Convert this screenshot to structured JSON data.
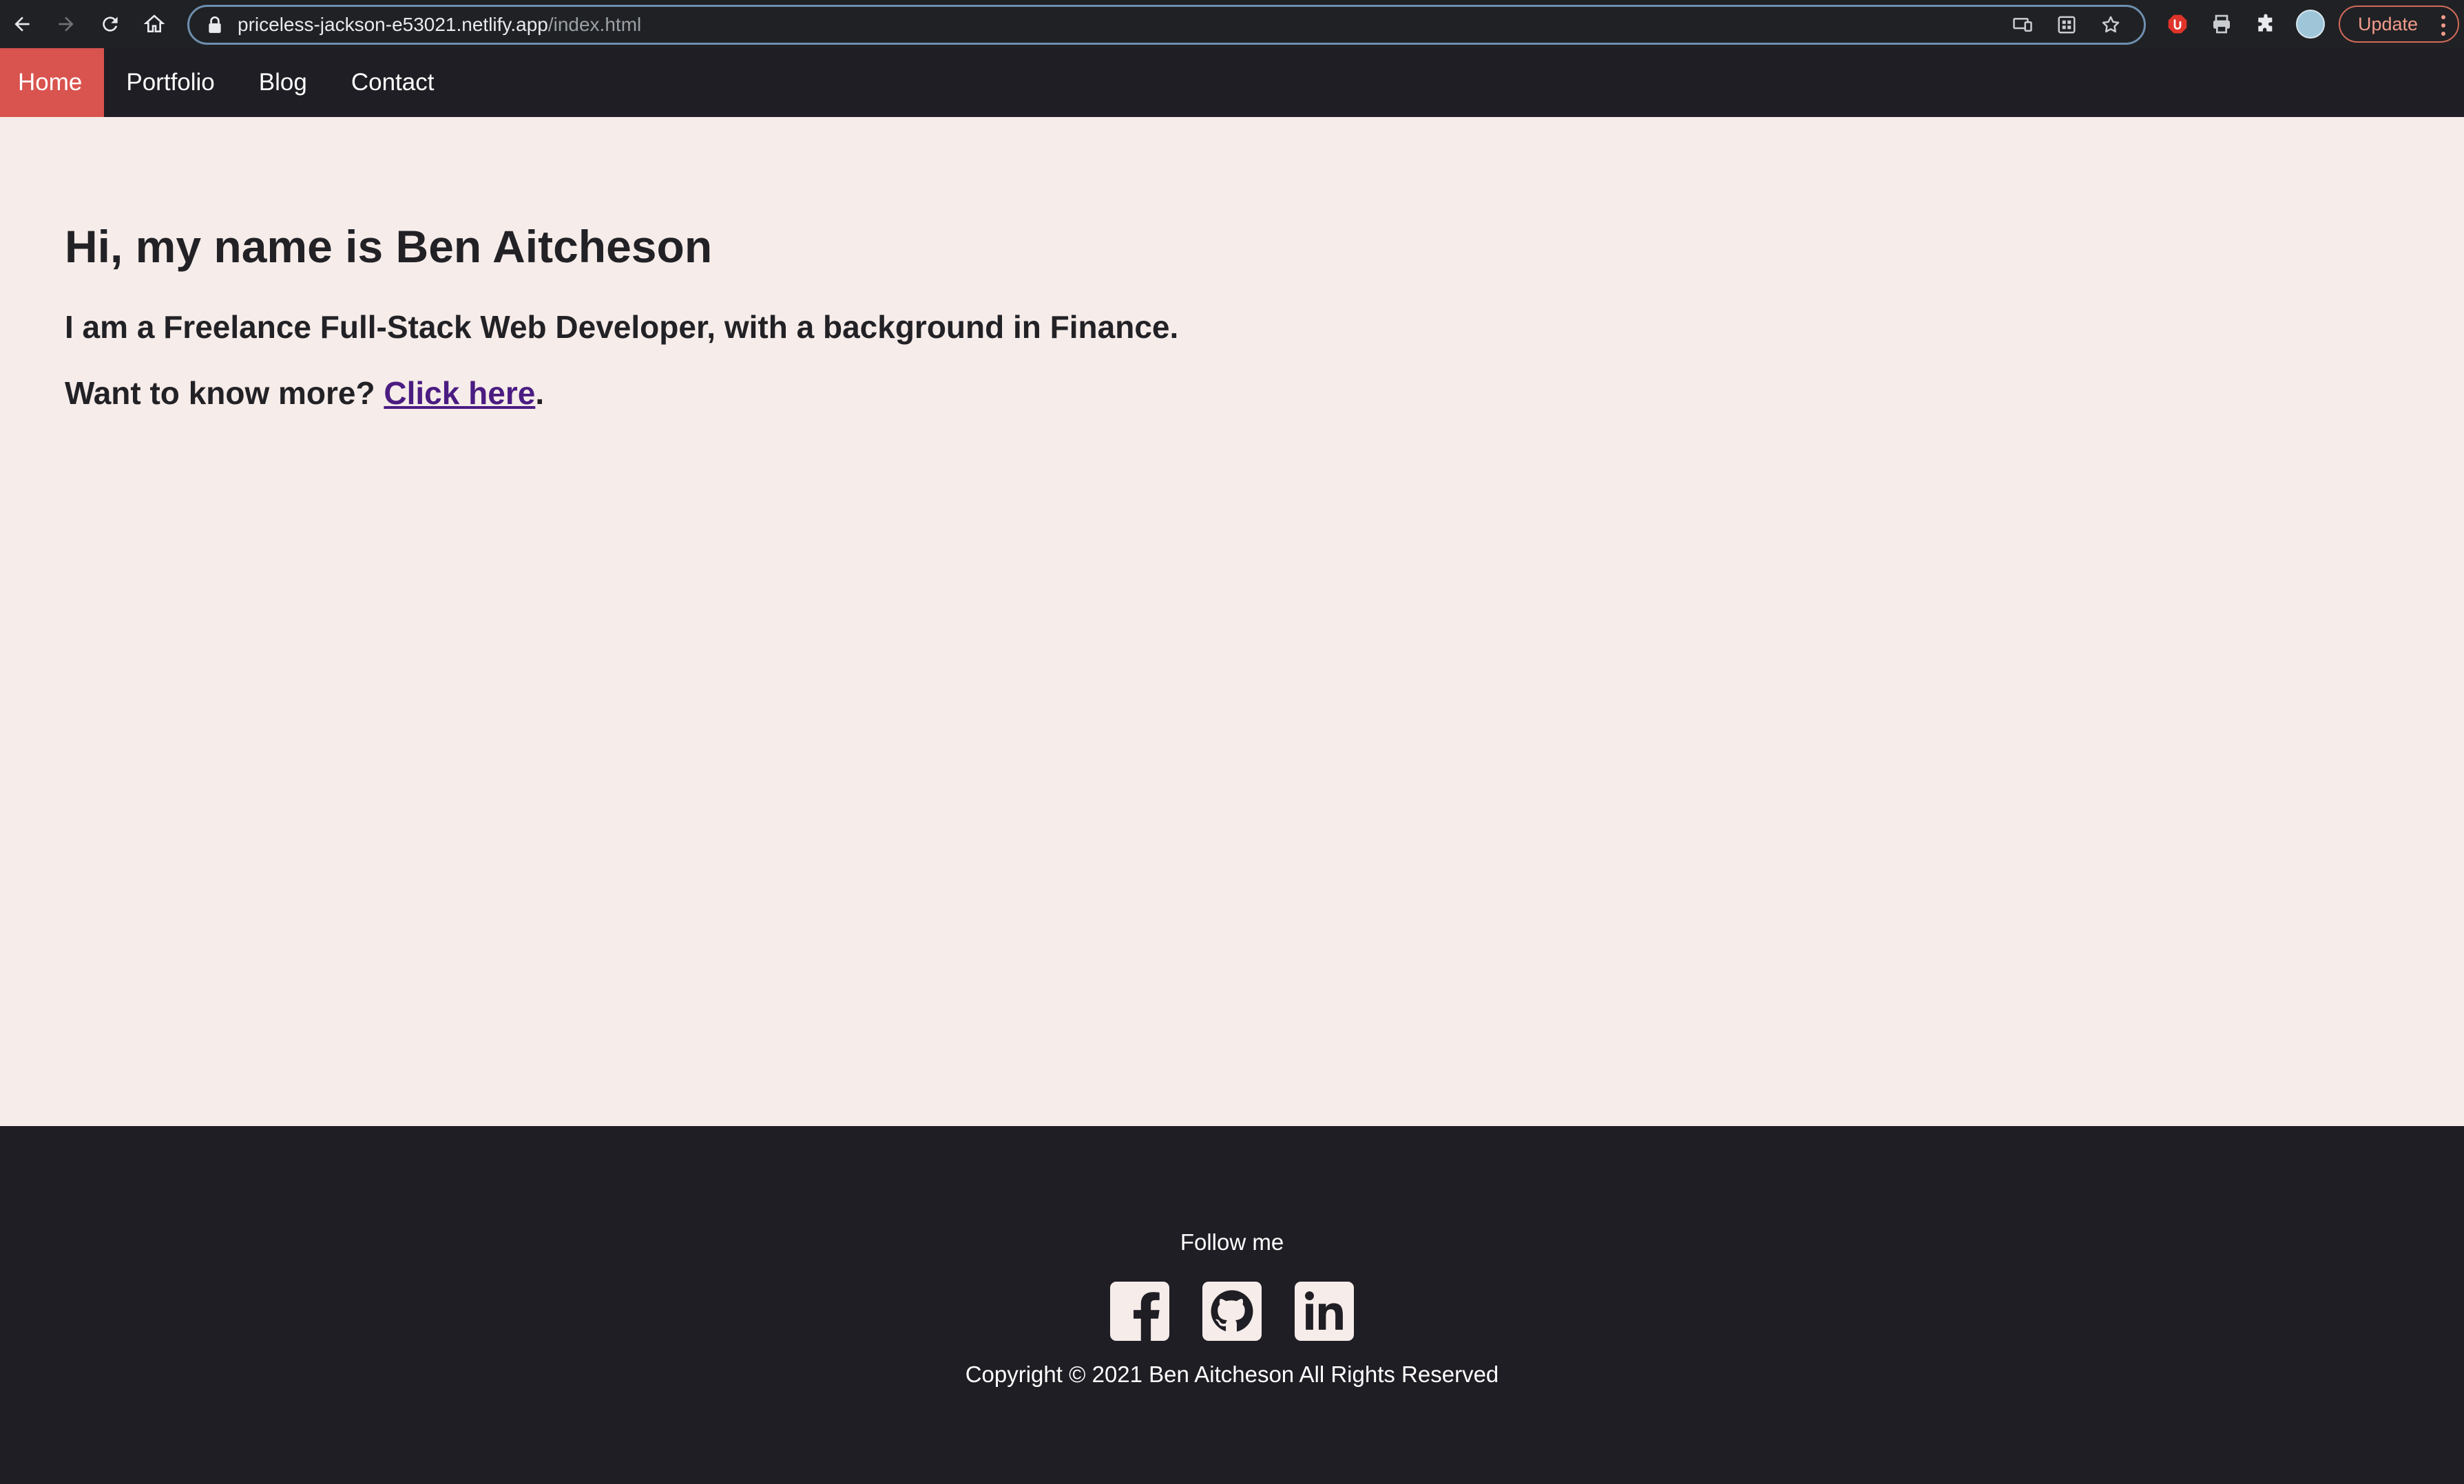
{
  "browser": {
    "url_host": "priceless-jackson-e53021.netlify.app",
    "url_path": "/index.html",
    "update_label": "Update",
    "accent_color": "#d9534f"
  },
  "nav": {
    "items": [
      {
        "label": "Home",
        "active": true
      },
      {
        "label": "Portfolio",
        "active": false
      },
      {
        "label": "Blog",
        "active": false
      },
      {
        "label": "Contact",
        "active": false
      }
    ]
  },
  "hero": {
    "heading": "Hi, my name is Ben Aitcheson",
    "line1": "I am a Freelance Full-Stack Web Developer, with a background in Finance.",
    "line2_prefix": "Want to know more? ",
    "line2_link": "Click here",
    "line2_suffix": "."
  },
  "footer": {
    "follow_label": "Follow me",
    "socials": [
      "facebook-icon",
      "github-icon",
      "linkedin-icon"
    ],
    "copyright": "Copyright © 2021 Ben Aitcheson All Rights Reserved"
  }
}
